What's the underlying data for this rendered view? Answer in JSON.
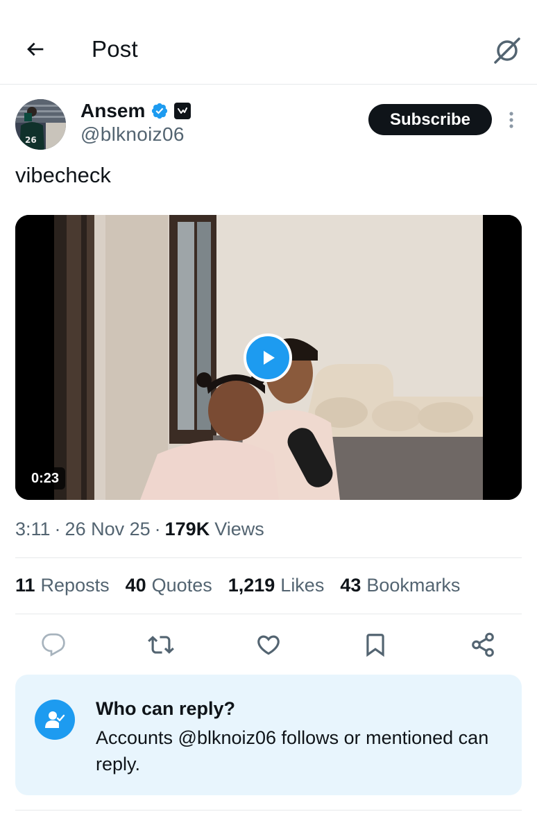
{
  "header": {
    "title": "Post",
    "back_icon": "arrow-left-icon",
    "grok_icon": "grok-icon"
  },
  "author": {
    "display_name": "Ansem",
    "handle": "@blknoiz06",
    "verified_color": "#1d9bf0",
    "avatar_jersey_number": "26"
  },
  "subscribe_label": "Subscribe",
  "post": {
    "text": "vibecheck",
    "video_duration": "0:23"
  },
  "meta": {
    "time": "3:11",
    "date": "26 Nov 25",
    "views_count": "179K",
    "views_label": "Views",
    "separator": "·"
  },
  "stats": [
    {
      "count": "11",
      "label": "Reposts"
    },
    {
      "count": "40",
      "label": "Quotes"
    },
    {
      "count": "1,219",
      "label": "Likes"
    },
    {
      "count": "43",
      "label": "Bookmarks"
    }
  ],
  "actions": [
    "reply-icon",
    "repost-icon",
    "like-icon",
    "bookmark-icon",
    "share-icon"
  ],
  "reply_restriction": {
    "title": "Who can reply?",
    "description": "Accounts @blknoiz06 follows or mentioned can reply."
  },
  "colors": {
    "accent": "#1d9bf0",
    "text_primary": "#0f1419",
    "text_secondary": "#536471",
    "card_bg": "#e8f5fd"
  }
}
